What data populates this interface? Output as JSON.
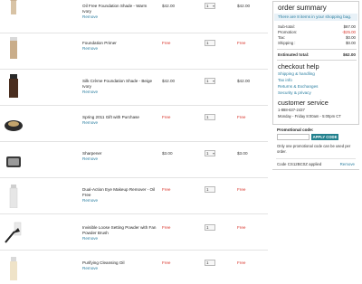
{
  "cart": {
    "items": [
      {
        "name": "Oil Free Foundation Shade - Warm Ivory",
        "remove": "Remove",
        "price": "$42.00",
        "qty": "1",
        "qty_select": true,
        "total": "$42.00",
        "free": false,
        "icon": "foundation-bottle-icon"
      },
      {
        "name": "Foundation Primer",
        "remove": "Remove",
        "price": "Free",
        "qty": "1",
        "qty_select": false,
        "total": "Free",
        "free": true,
        "icon": "primer-tube-icon"
      },
      {
        "name": "Silk Crème Foundation Shade - Beige Ivory",
        "remove": "Remove",
        "price": "$42.00",
        "qty": "1",
        "qty_select": true,
        "total": "$42.00",
        "free": false,
        "icon": "foundation-jar-icon"
      },
      {
        "name": "Spring 2011 Gift with Purchase",
        "remove": "Remove",
        "price": "Free",
        "qty": "1",
        "qty_select": false,
        "total": "Free",
        "free": true,
        "icon": "gift-pouch-icon"
      },
      {
        "name": "Sharpener",
        "remove": "Remove",
        "price": "$3.00",
        "qty": "1",
        "qty_select": true,
        "total": "$3.00",
        "free": false,
        "icon": "sharpener-icon"
      },
      {
        "name": "Dual-Action Eye Makeup Remover - Oil Free",
        "remove": "Remove",
        "price": "Free",
        "qty": "1",
        "qty_select": false,
        "total": "Free",
        "free": true,
        "icon": "remover-bottle-icon"
      },
      {
        "name": "Invisible Loose Setting Powder with Fan Powder Brush",
        "remove": "Remove",
        "price": "Free",
        "qty": "1",
        "qty_select": false,
        "total": "Free",
        "free": true,
        "icon": "powder-brush-icon"
      },
      {
        "name": "Purifying Cleansing Oil",
        "remove": "Remove",
        "price": "Free",
        "qty": "1",
        "qty_select": false,
        "total": "Free",
        "free": true,
        "icon": "cleansing-oil-icon"
      }
    ]
  },
  "summary": {
    "title": "order summary",
    "notice": "There are 8 items in your shopping bag.",
    "subtotal_label": "Sub-total:",
    "subtotal_value": "$87.00",
    "promotion_label": "Promotion:",
    "promotion_value": "-$25.00",
    "tax_label": "Tax:",
    "tax_value": "$0.00",
    "shipping_label": "Shipping :",
    "shipping_value": "$0.00",
    "estimated_label": "Estimated total:",
    "estimated_value": "$62.00",
    "accent_color": "#2a7ea0",
    "discount_color": "#d9342b"
  },
  "checkout_help": {
    "title": "checkout help",
    "links": [
      "Shipping & handling",
      "Tax info",
      "Returns & Exchanges",
      "Security & privacy"
    ]
  },
  "customer_service": {
    "title": "customer service",
    "phone": "1-888-637-2437",
    "hours": "Monday - Friday 8:00am - 5:00pm CT"
  },
  "promo": {
    "label": "Promotional code:",
    "input_value": "",
    "apply_label": "APPLY CODE",
    "note": "Only one promotional code can be used per order.",
    "applied": "Code CS12BC0Z applied",
    "remove_label": "Remove",
    "button_color": "#21808d"
  }
}
